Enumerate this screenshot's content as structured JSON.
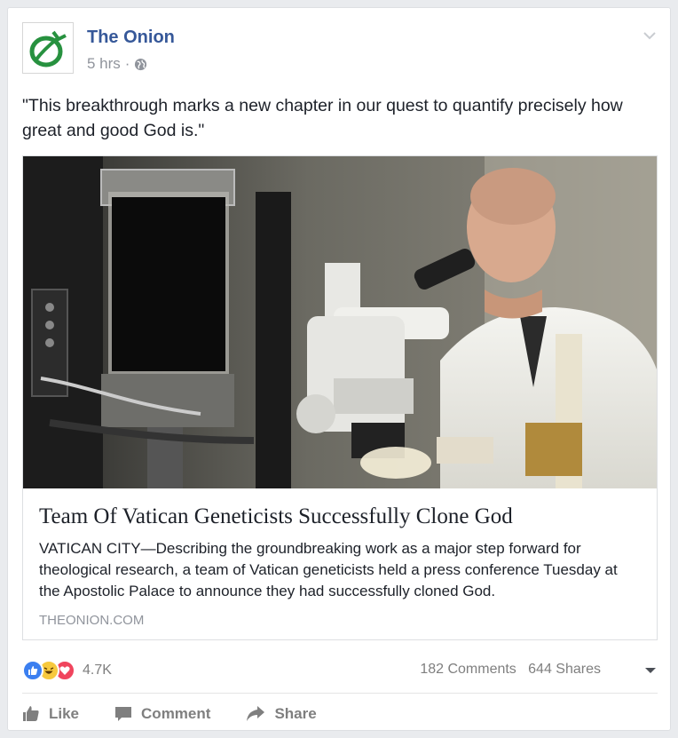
{
  "post": {
    "page_name": "The Onion",
    "time": "5 hrs",
    "time_separator": "·",
    "text": "\"This breakthrough marks a new chapter in our quest to quantify precisely how great and good God is.\""
  },
  "link": {
    "title": "Team Of Vatican Geneticists Successfully Clone God",
    "description": "VATICAN CITY—Describing the groundbreaking work as a major step forward for theological research, a team of Vatican geneticists held a press conference Tuesday at the Apostolic Palace to announce they had successfully cloned God.",
    "domain": "THEONION.COM"
  },
  "reactions": {
    "icons": [
      "like-icon",
      "haha-icon",
      "love-icon"
    ],
    "count": "4.7K",
    "comments": "182 Comments",
    "shares": "644 Shares"
  },
  "actions": {
    "like": "Like",
    "comment": "Comment",
    "share": "Share"
  },
  "colors": {
    "link_blue": "#365899",
    "onion_green": "#27913f",
    "like_blue": "#3b7ff0",
    "haha_yellow": "#f7c93e",
    "love_red": "#f0445d",
    "muted_gray": "#90949c"
  }
}
